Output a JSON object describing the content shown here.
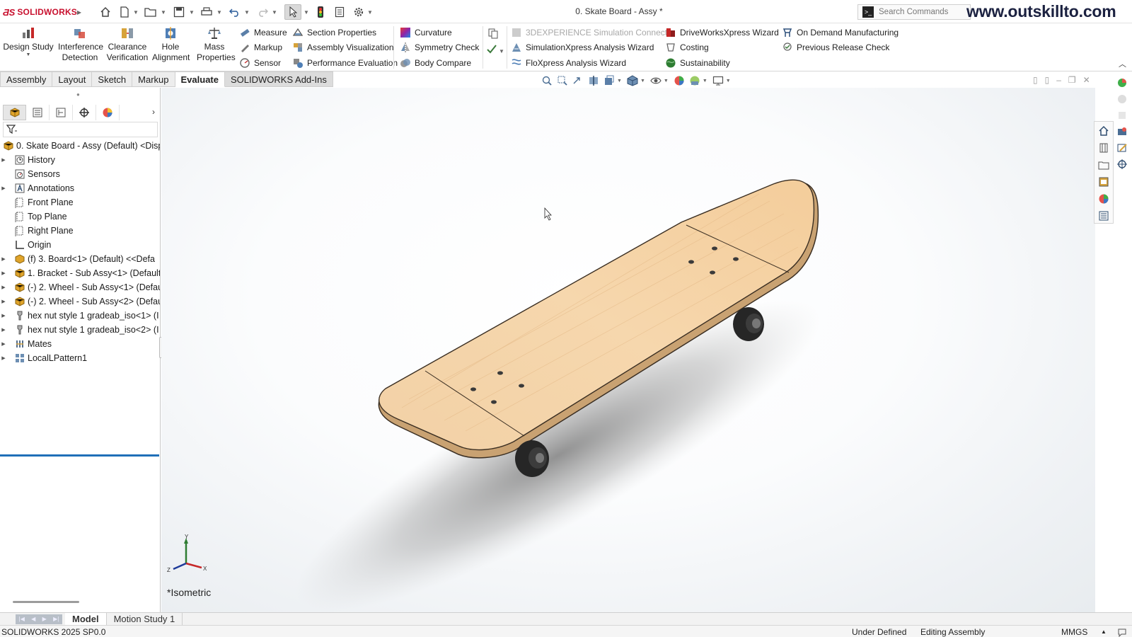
{
  "app": {
    "brand": "SOLIDWORKS",
    "document_title": "0. Skate Board - Assy *",
    "search_placeholder": "Search Commands",
    "watermark": "www.outskillto.com"
  },
  "ribbon": {
    "big_buttons": [
      {
        "label": "Design Study",
        "icon": "design-study-icon"
      },
      {
        "label": "Interference Detection",
        "icon": "interference-detection-icon"
      },
      {
        "label": "Clearance Verification",
        "icon": "clearance-verification-icon"
      },
      {
        "label": "Hole Alignment",
        "icon": "hole-alignment-icon"
      },
      {
        "label": "Mass Properties",
        "icon": "mass-properties-icon"
      }
    ],
    "col1": [
      "Measure",
      "Markup",
      "Sensor"
    ],
    "col2": [
      "Section Properties",
      "Assembly Visualization",
      "Performance Evaluation"
    ],
    "col3": [
      "Curvature",
      "Symmetry Check",
      "Body Compare"
    ],
    "col4": [
      "3DEXPERIENCE Simulation Connector",
      "SimulationXpress Analysis Wizard",
      "FloXpress Analysis Wizard"
    ],
    "col5": [
      "DriveWorksXpress Wizard",
      "Costing",
      "Sustainability"
    ],
    "col6": [
      "On Demand Manufacturing",
      "Previous Release Check"
    ]
  },
  "tabs": [
    "Assembly",
    "Layout",
    "Sketch",
    "Markup",
    "Evaluate",
    "SOLIDWORKS Add-Ins"
  ],
  "active_tab": "Evaluate",
  "feature_tree": {
    "root": "0. Skate Board - Assy (Default) <Disp",
    "nodes": [
      {
        "label": "History",
        "expandable": true,
        "icon": "history-icon"
      },
      {
        "label": "Sensors",
        "expandable": false,
        "icon": "sensors-icon"
      },
      {
        "label": "Annotations",
        "expandable": true,
        "icon": "annotations-icon"
      },
      {
        "label": "Front Plane",
        "expandable": false,
        "icon": "plane-icon"
      },
      {
        "label": "Top Plane",
        "expandable": false,
        "icon": "plane-icon"
      },
      {
        "label": "Right Plane",
        "expandable": false,
        "icon": "plane-icon"
      },
      {
        "label": "Origin",
        "expandable": false,
        "icon": "origin-icon"
      },
      {
        "label": "(f) 3. Board<1> (Default) <<Defa",
        "expandable": true,
        "icon": "part-icon"
      },
      {
        "label": "1. Bracket - Sub Assy<1> (Default",
        "expandable": true,
        "icon": "subassembly-icon"
      },
      {
        "label": "(-) 2. Wheel - Sub Assy<1> (Defau",
        "expandable": true,
        "icon": "subassembly-icon"
      },
      {
        "label": "(-) 2. Wheel - Sub Assy<2> (Defau",
        "expandable": true,
        "icon": "subassembly-icon"
      },
      {
        "label": "hex nut style 1 gradeab_iso<1> (I",
        "expandable": true,
        "icon": "toolbox-part-icon"
      },
      {
        "label": "hex nut style 1 gradeab_iso<2> (I",
        "expandable": true,
        "icon": "toolbox-part-icon"
      },
      {
        "label": "Mates",
        "expandable": true,
        "icon": "mates-icon"
      },
      {
        "label": "LocalLPattern1",
        "expandable": true,
        "icon": "pattern-icon"
      }
    ]
  },
  "viewport": {
    "view_name": "*Isometric",
    "triad": {
      "x": "X",
      "y": "Y",
      "z": "Z"
    }
  },
  "bottom_tabs": [
    "Model",
    "Motion Study 1"
  ],
  "status": {
    "version": "SOLIDWORKS 2025 SP0.0",
    "definition": "Under Defined",
    "mode": "Editing Assembly",
    "units": "MMGS"
  },
  "colors": {
    "brand_red": "#c8102e",
    "selection_blue": "#1f6fb8",
    "deck_wood": "#f1cfa3",
    "wheel": "#2e2e2e"
  }
}
